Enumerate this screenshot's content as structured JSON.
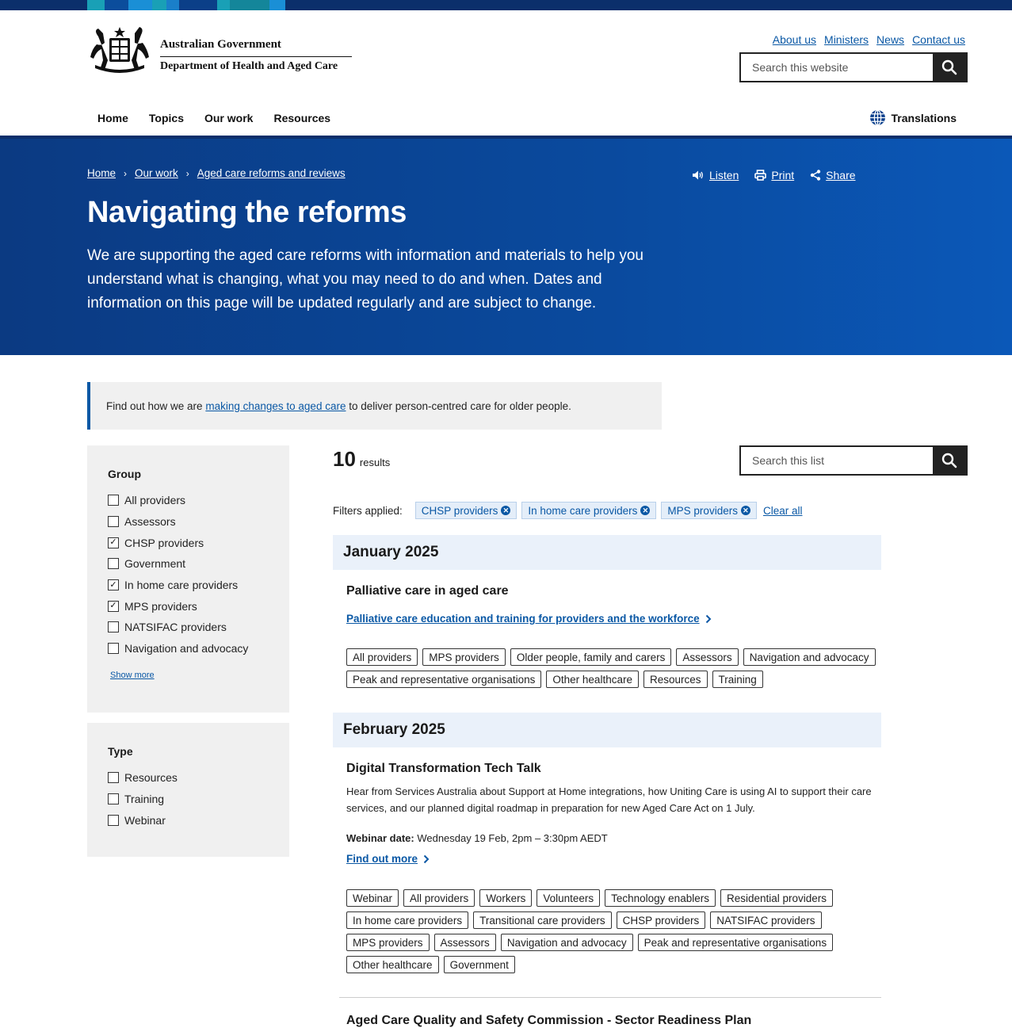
{
  "header": {
    "gov_line1": "Australian Government",
    "gov_line2": "Department of Health and Aged Care",
    "util_links": [
      "About us",
      "Ministers",
      "News",
      "Contact us"
    ],
    "search_placeholder": "Search this website",
    "nav": [
      "Home",
      "Topics",
      "Our work",
      "Resources"
    ],
    "nav_active": "Our work",
    "translations": "Translations"
  },
  "hero": {
    "breadcrumb": [
      "Home",
      "Our work",
      "Aged care reforms and reviews"
    ],
    "tools": {
      "listen": "Listen",
      "print": "Print",
      "share": "Share"
    },
    "title": "Navigating the reforms",
    "intro": "We are supporting the aged care reforms with information and materials to help you understand what is changing, what you may need to do and when. Dates and information on this page will be updated regularly and are subject to change."
  },
  "callout": {
    "before": "Find out how we are ",
    "link": "making changes to aged care",
    "after": " to deliver person-centred care for older people."
  },
  "filters": {
    "group": {
      "title": "Group",
      "items": [
        {
          "label": "All providers",
          "checked": false
        },
        {
          "label": "Assessors",
          "checked": false
        },
        {
          "label": "CHSP providers",
          "checked": true
        },
        {
          "label": "Government",
          "checked": false
        },
        {
          "label": "In home care providers",
          "checked": true
        },
        {
          "label": "MPS providers",
          "checked": true
        },
        {
          "label": "NATSIFAC providers",
          "checked": false
        },
        {
          "label": "Navigation and advocacy",
          "checked": false
        }
      ],
      "show_more": "Show more"
    },
    "type": {
      "title": "Type",
      "items": [
        {
          "label": "Resources",
          "checked": false
        },
        {
          "label": "Training",
          "checked": false
        },
        {
          "label": "Webinar",
          "checked": false
        }
      ]
    }
  },
  "results": {
    "count": "10",
    "count_label": "results",
    "search_placeholder": "Search this list",
    "filters_applied_label": "Filters applied:",
    "applied": [
      "CHSP providers",
      "In home care providers",
      "MPS providers"
    ],
    "clear_all": "Clear all"
  },
  "months": {
    "jan": "January 2025",
    "feb": "February 2025"
  },
  "items": {
    "palliative": {
      "title": "Palliative care in aged care",
      "link": "Palliative care education and training for providers and the workforce",
      "tags": [
        "All providers",
        "MPS providers",
        "Older people, family and carers",
        "Assessors",
        "Navigation and advocacy",
        "Peak and representative organisations",
        "Other healthcare",
        "Resources",
        "Training"
      ]
    },
    "digital": {
      "title": "Digital Transformation Tech Talk",
      "desc": "Hear from Services Australia about Support at Home integrations, how Uniting Care is using AI to support their care services, and our planned digital roadmap in preparation for new Aged Care Act on 1 July.",
      "date_label": "Webinar date:",
      "date_value": " Wednesday 19 Feb, 2pm – 3:30pm AEDT",
      "link": "Find out more",
      "tags": [
        "Webinar",
        "All providers",
        "Workers",
        "Volunteers",
        "Technology enablers",
        "Residential providers",
        "In home care providers",
        "Transitional care providers",
        "CHSP providers",
        "NATSIFAC providers",
        "MPS providers",
        "Assessors",
        "Navigation and advocacy",
        "Peak and representative organisations",
        "Other healthcare",
        "Government"
      ]
    },
    "commission": {
      "title": "Aged Care Quality and Safety Commission - Sector Readiness Plan"
    }
  }
}
